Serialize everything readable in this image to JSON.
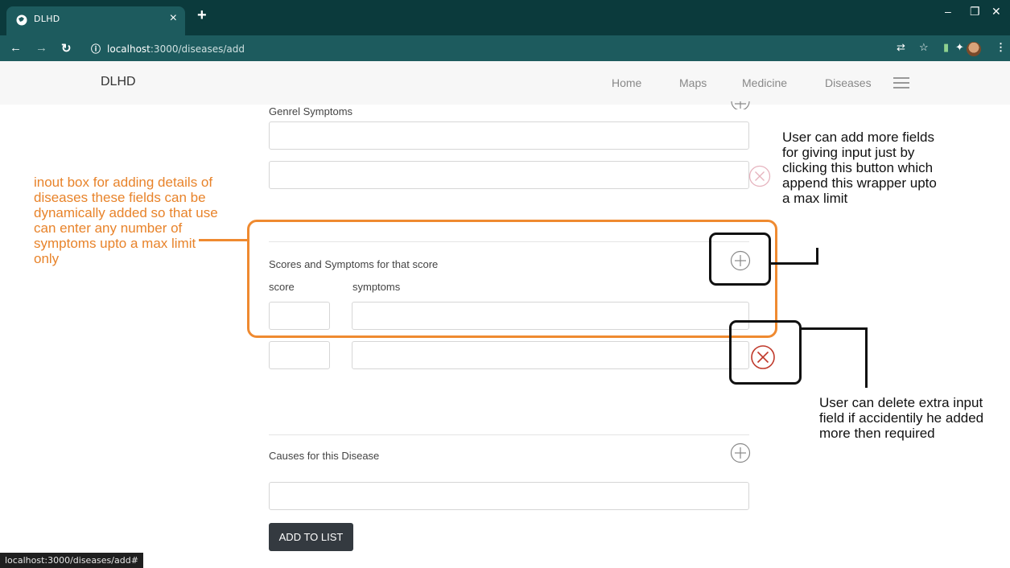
{
  "browser": {
    "tab_title": "DLHD",
    "url_host": "localhost",
    "url_path": ":3000/diseases/add",
    "status_url": "localhost:3000/diseases/add#"
  },
  "navbar": {
    "brand": "DLHD",
    "links": [
      "Home",
      "Maps",
      "Medicine",
      "Diseases"
    ]
  },
  "form": {
    "general_symptoms_label": "Genrel Symptoms",
    "scores_section_label": "Scores and Symptoms for that score",
    "score_col_label": "score",
    "symptoms_col_label": "symptoms",
    "causes_label": "Causes for this Disease",
    "submit_label": "ADD TO LIST"
  },
  "annotations": {
    "left_note": "inout box for adding details of diseases these fields can be dynamically added so that use can enter any number of symptoms upto a max limit only",
    "add_note": "User can add more fields for giving input just by clicking this button which append this wrapper upto a max limit",
    "delete_note": "User can delete extra input field if accidentily he added more then required"
  },
  "colors": {
    "browser_dark": "#0b3a3c",
    "browser_tab": "#1d5b5e",
    "navbar_bg": "#f7f7f7",
    "button_bg": "#343a40",
    "delete_active": "#c0392b",
    "delete_faded": "#e6b3be",
    "annotation_orange": "#ef8a30"
  }
}
